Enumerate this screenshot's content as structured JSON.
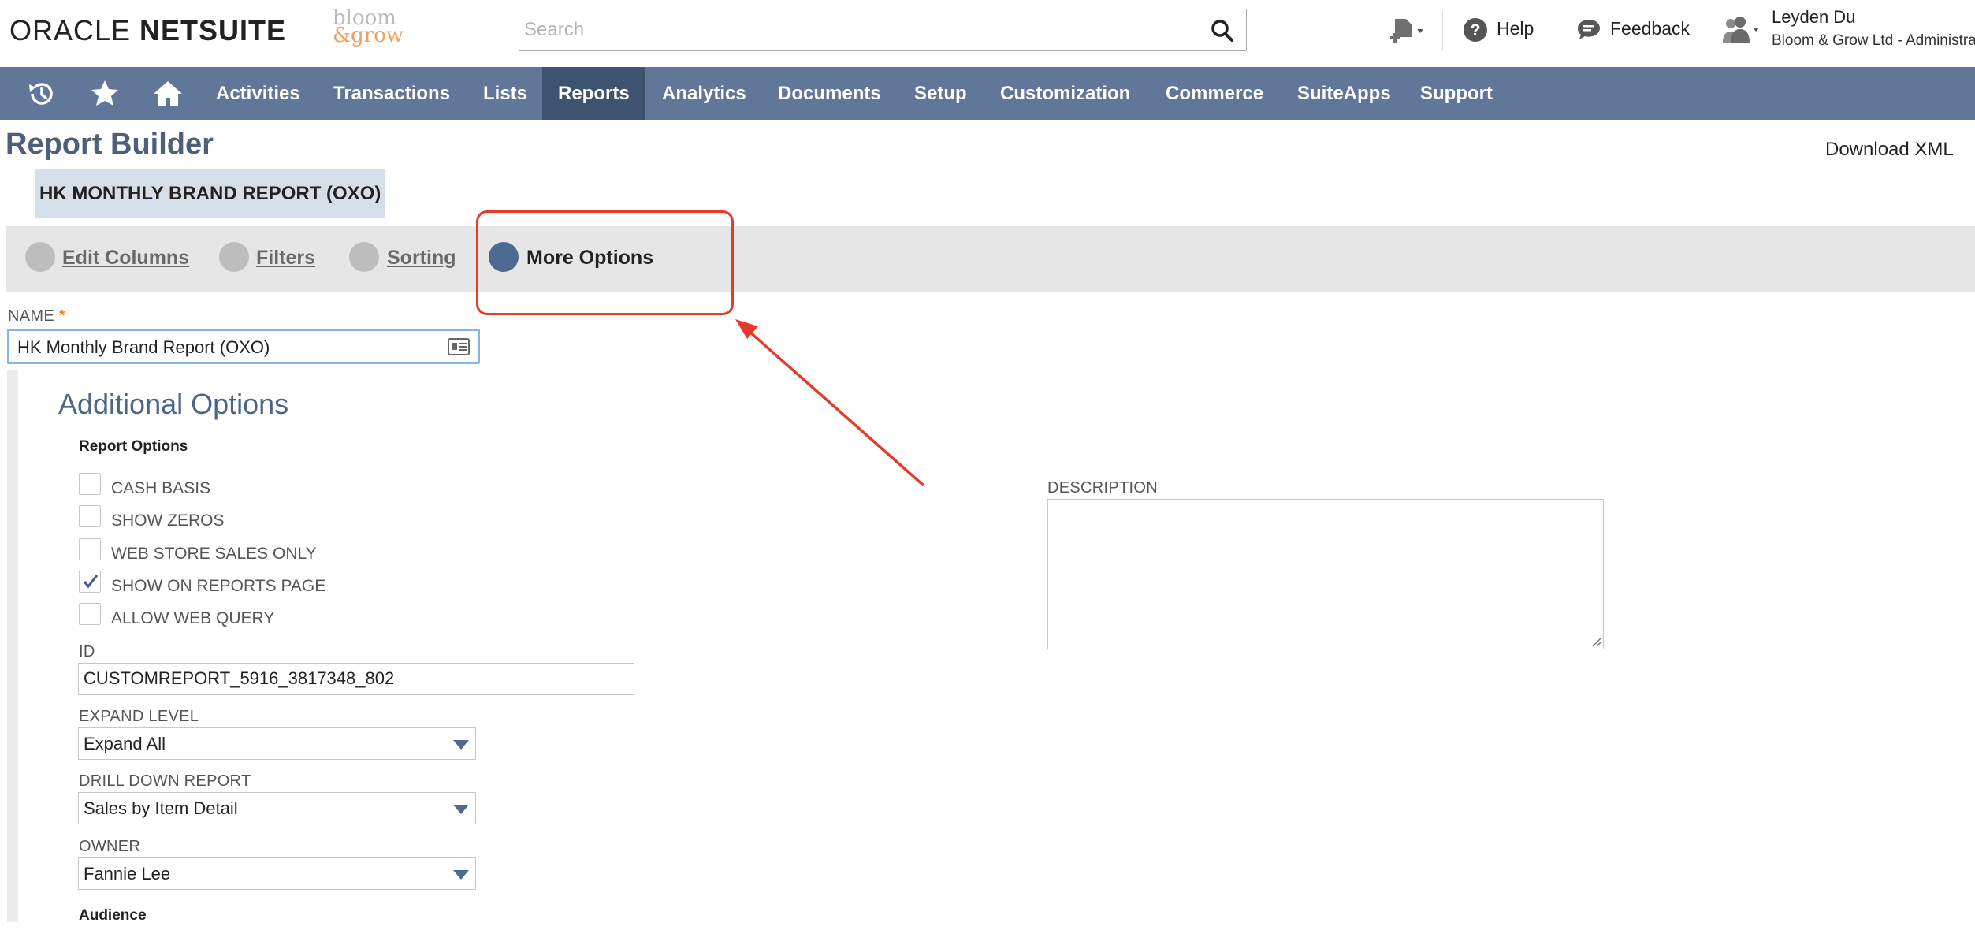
{
  "header": {
    "logo_left": "ORACLE ",
    "logo_right": "NETSUITE",
    "brand_logo_line1": "bloom",
    "brand_logo_line2": "&grow",
    "search_placeholder": "Search",
    "help_label": "Help",
    "feedback_label": "Feedback",
    "user_name": "Leyden Du",
    "user_role": "Bloom & Grow Ltd - Administrator"
  },
  "nav": {
    "items": [
      {
        "label": "Activities"
      },
      {
        "label": "Transactions"
      },
      {
        "label": "Lists"
      },
      {
        "label": "Reports",
        "active": true
      },
      {
        "label": "Analytics"
      },
      {
        "label": "Documents"
      },
      {
        "label": "Setup"
      },
      {
        "label": "Customization"
      },
      {
        "label": "Commerce"
      },
      {
        "label": "SuiteApps"
      },
      {
        "label": "Support"
      }
    ]
  },
  "page": {
    "title": "Report Builder",
    "download_label": "Download XML",
    "report_tab": "HK MONTHLY BRAND REPORT (OXO)",
    "steps": [
      {
        "label": "Edit Columns",
        "active": false
      },
      {
        "label": "Filters",
        "active": false
      },
      {
        "label": "Sorting",
        "active": false
      },
      {
        "label": "More Options",
        "active": true
      }
    ]
  },
  "form": {
    "name_label": "NAME",
    "required_marker": "*",
    "name_value": "HK Monthly Brand Report (OXO)",
    "section_title": "Additional Options",
    "report_options_title": "Report Options",
    "checkboxes": [
      {
        "label": "CASH BASIS",
        "checked": false
      },
      {
        "label": "SHOW ZEROS",
        "checked": false
      },
      {
        "label": "WEB STORE SALES ONLY",
        "checked": false
      },
      {
        "label": "SHOW ON REPORTS PAGE",
        "checked": true
      },
      {
        "label": "ALLOW WEB QUERY",
        "checked": false
      }
    ],
    "id_label": "ID",
    "id_value": "CUSTOMREPORT_5916_3817348_802",
    "expand_level_label": "EXPAND LEVEL",
    "expand_level_value": "Expand All",
    "drill_down_label": "DRILL DOWN REPORT",
    "drill_down_value": "Sales by Item Detail",
    "owner_label": "OWNER",
    "owner_value": "Fannie Lee",
    "description_label": "DESCRIPTION",
    "description_value": "",
    "audience_label": "Audience"
  },
  "colors": {
    "nav_bg": "#607799",
    "nav_active": "#3e5370",
    "step_active": "#4f6a92",
    "annotation": "#e63a2a"
  }
}
